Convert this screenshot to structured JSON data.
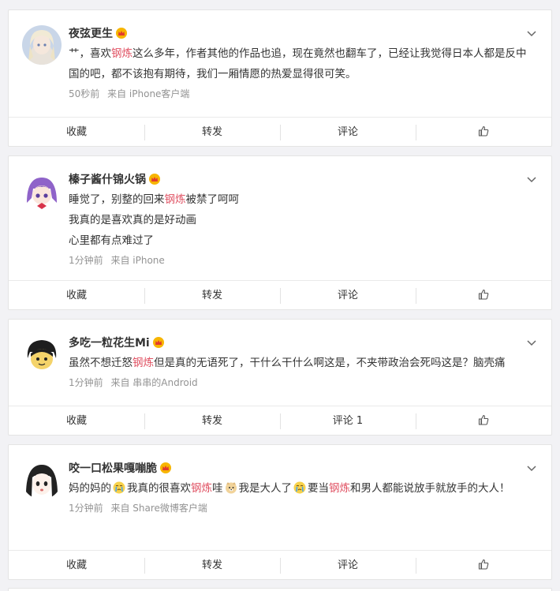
{
  "colors": {
    "highlight": "#e05263",
    "meta": "#939393",
    "background": "#f2f2f5"
  },
  "actions": {
    "collect": "收藏",
    "repost": "转发",
    "comment": "评论",
    "like_icon": "thumbs-up-icon"
  },
  "posts": [
    {
      "username": "夜弦更生",
      "badge": "vip-crown-icon",
      "segments": [
        {
          "t": "艹，喜欢"
        },
        {
          "t": "钢炼",
          "hl": true
        },
        {
          "t": "这么多年，作者其他的作品也追，现在竟然也翻车了，已经让我觉得日本人都是反中国的吧，都不该抱有期待，我们一厢情愿的热爱显得很可笑。"
        }
      ],
      "time": "50秒前",
      "source": "来自 iPhone客户端",
      "comment_label": "评论"
    },
    {
      "username": "榛子酱什锦火锅",
      "badge": "vip-crown-icon",
      "lines": [
        [
          {
            "t": "睡觉了，别整的回来"
          },
          {
            "t": "钢炼",
            "hl": true
          },
          {
            "t": "被禁了呵呵"
          }
        ],
        [
          {
            "t": "我真的是喜欢真的是好动画"
          }
        ],
        [
          {
            "t": "心里都有点难过了"
          }
        ]
      ],
      "time": "1分钟前",
      "source": "来自 iPhone",
      "comment_label": "评论"
    },
    {
      "username": "多吃一粒花生Mi",
      "badge": "vip-crown-icon",
      "segments": [
        {
          "t": "虽然不想迁怒"
        },
        {
          "t": "钢炼",
          "hl": true
        },
        {
          "t": "但是真的无语死了，干什么干什么啊这是，不夹带政治会死吗这是？脑壳痛"
        }
      ],
      "time": "1分钟前",
      "source": "来自 串串的Android",
      "comment_label": "评论 1"
    },
    {
      "username": "咬一口松果嘎嘣脆",
      "badge": "vip-crown-icon",
      "segments": [
        {
          "t": "妈的妈的"
        },
        {
          "emoji": "crying-face-emoji"
        },
        {
          "t": "我真的很喜欢"
        },
        {
          "t": "钢炼",
          "hl": true
        },
        {
          "t": "哇"
        },
        {
          "emoji": "doge-emoji"
        },
        {
          "t": "我是大人了"
        },
        {
          "emoji": "crying-face-emoji"
        },
        {
          "t": "要当"
        },
        {
          "t": "钢炼",
          "hl": true
        },
        {
          "t": "和男人都能说放手就放手的大人！"
        }
      ],
      "time": "1分钟前",
      "source": "来自 Share微博客户端",
      "comment_label": "评论"
    }
  ]
}
